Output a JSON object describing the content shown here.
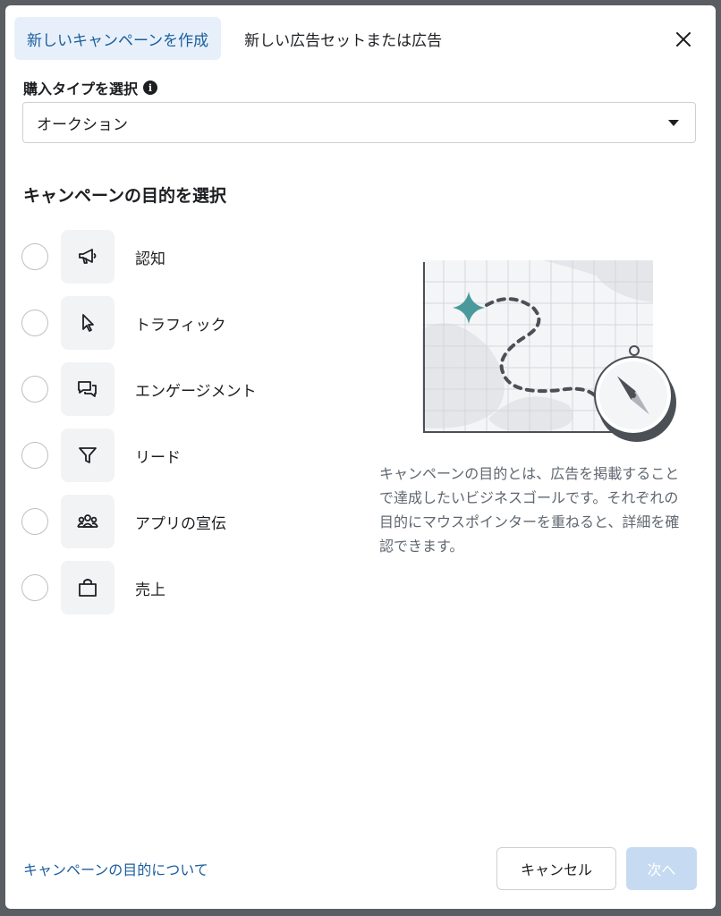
{
  "tabs": [
    {
      "label": "新しいキャンペーンを作成",
      "active": true
    },
    {
      "label": "新しい広告セットまたは広告",
      "active": false
    }
  ],
  "purchase_type": {
    "label": "購入タイプを選択",
    "info_icon": "info-icon",
    "selected": "オークション"
  },
  "objectives": {
    "title": "キャンペーンの目的を選択",
    "items": [
      {
        "label": "認知",
        "icon": "megaphone-icon"
      },
      {
        "label": "トラフィック",
        "icon": "cursor-icon"
      },
      {
        "label": "エンゲージメント",
        "icon": "chat-bubbles-icon"
      },
      {
        "label": "リード",
        "icon": "funnel-icon"
      },
      {
        "label": "アプリの宣伝",
        "icon": "people-icon"
      },
      {
        "label": "売上",
        "icon": "shopping-bag-icon"
      }
    ]
  },
  "help_text": "キャンペーンの目的とは、広告を掲載することで達成したいビジネスゴールです。それぞれの目的にマウスポインターを重ねると、詳細を確認できます。",
  "footer": {
    "link": "キャンペーンの目的について",
    "cancel": "キャンセル",
    "next": "次へ"
  },
  "colors": {
    "accent": "#1b5e9e",
    "active_tab_bg": "#e7f0fa",
    "disabled_button_bg": "#c6dbf2",
    "map_star": "#4a9a9b"
  }
}
